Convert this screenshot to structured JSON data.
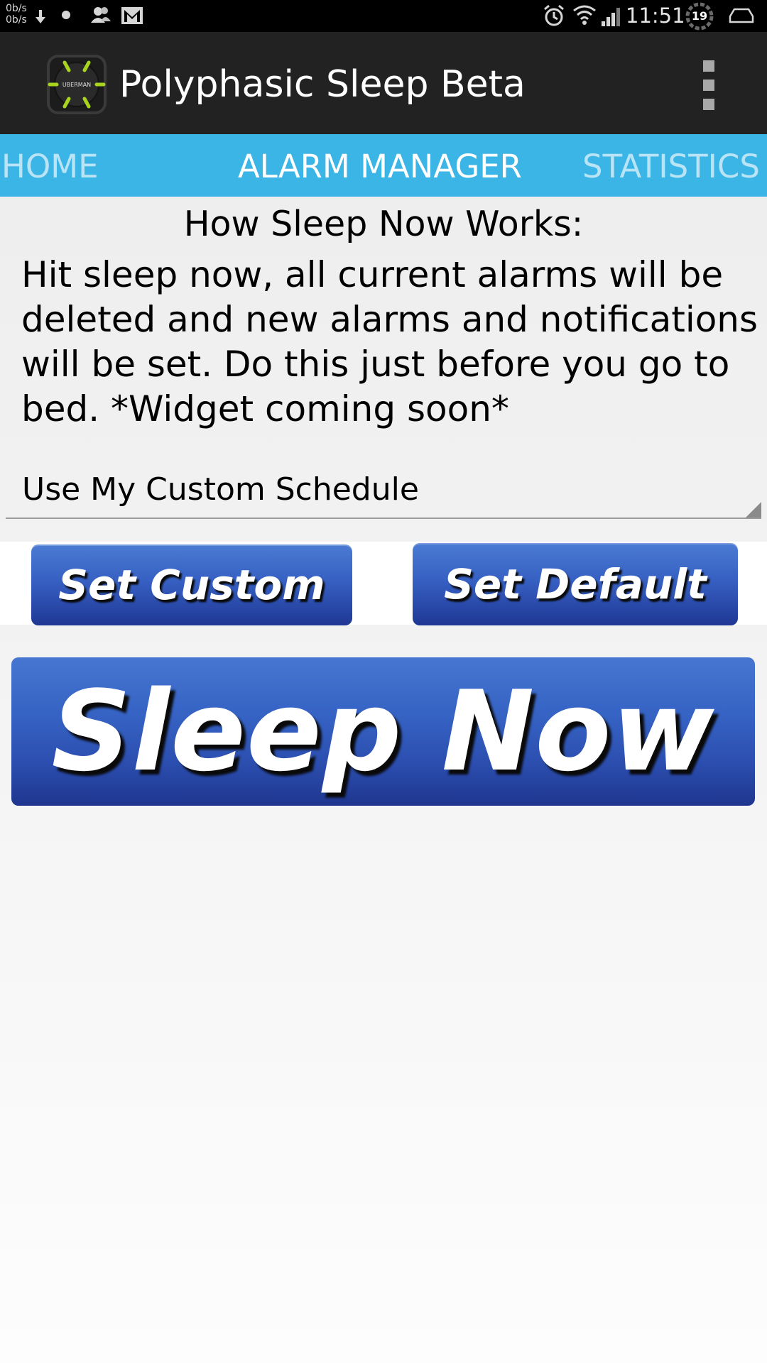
{
  "status_bar": {
    "net_up": "0b/s",
    "net_down": "0b/s",
    "time": "11:51",
    "battery_level": "19",
    "icons": [
      "download-icon",
      "dot-icon",
      "contacts-icon",
      "gmail-icon",
      "alarm-icon",
      "wifi-icon",
      "signal-icon",
      "battery-icon",
      "cast-icon"
    ]
  },
  "action_bar": {
    "title": "Polyphasic Sleep Beta",
    "logo_text": "UBERMAN",
    "menu_icon": "overflow-menu-icon"
  },
  "tabs": [
    {
      "label": "HOME",
      "active": false
    },
    {
      "label": "ALARM MANAGER",
      "active": true
    },
    {
      "label": "STATISTICS",
      "active": false
    }
  ],
  "content": {
    "heading": "How Sleep Now Works:",
    "description": "Hit sleep now, all current alarms will be deleted and new alarms and notifications will be set. Do this just before you go to bed. *Widget coming soon*",
    "schedule_selected": "Use My Custom Schedule"
  },
  "buttons": {
    "set_custom": "Set Custom",
    "set_default": "Set Default",
    "sleep_now": "Sleep Now"
  },
  "colors": {
    "tab_bar": "#3bb4e6",
    "action_bar": "#222222",
    "button_blue": "#3562c3",
    "logo_accent": "#a8d41e"
  }
}
